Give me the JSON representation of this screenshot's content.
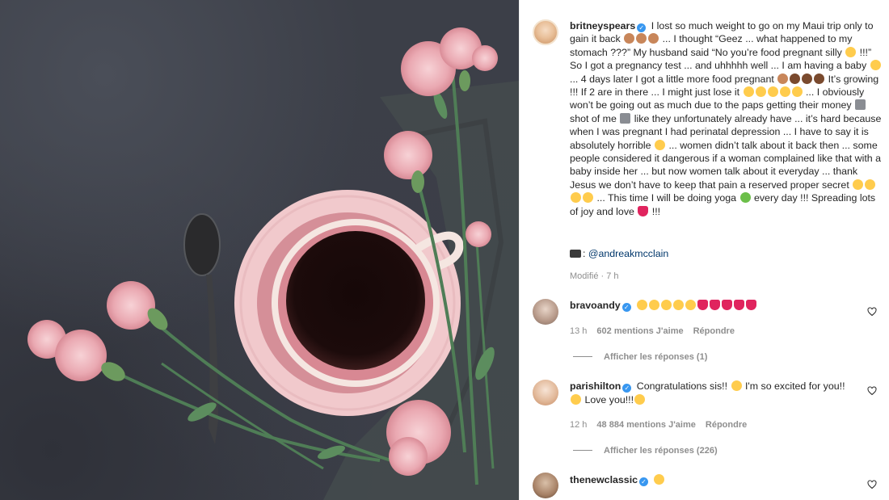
{
  "post": {
    "username": "britneyspears",
    "caption_parts": [
      " I lost so much weight to go on my Maui trip only to gain it back ",
      " ... I thought “Geez ... what happened to my stomach ???” My husband said “No you’re food pregnant silly ",
      " !!!” So I got a pregnancy test ... and uhhhhh well ... I am having a baby ",
      " ... 4 days later I got a little more food pregnant ",
      " It’s growing !!! If 2 are in there ... I might just lose it ",
      " ... I obviously won’t be going out as much due to the paps getting their money ",
      " shot of me ",
      " like they unfortunately already have ... it’s hard because when I was pregnant I had perinatal depression ... I have to say it is absolutely horrible ",
      " ... women didn’t talk about it back then ... some people considered it dangerous if a woman complained like that with a baby inside her ... but now women talk about it everyday ... thank Jesus we don’t have to keep that pain a reserved proper secret ",
      " ... This time I will be doing yoga ",
      " every day !!! Spreading lots of joy and love ",
      " !!!"
    ],
    "credit_prefix": ": ",
    "credit_handle": "@andreakmcclain",
    "modified": "Modifié · 7 h"
  },
  "comments": [
    {
      "username": "bravoandy",
      "text": "",
      "time": "13 h",
      "likes": "602 mentions J'aime",
      "reply_label": "Répondre",
      "view_replies": "Afficher les réponses (1)"
    },
    {
      "username": "parishilton",
      "text": " Congratulations sis!! ",
      "text2": " I'm so excited for you!! ",
      "text3": " Love you!!!",
      "time": "12 h",
      "likes": "48 884 mentions J'aime",
      "reply_label": "Répondre",
      "view_replies": "Afficher les réponses (226)"
    },
    {
      "username": "thenewclassic",
      "text": ""
    }
  ],
  "icons": {
    "verified": "verified-badge-icon",
    "like": "heart-outline-icon",
    "camera": "camera-icon"
  },
  "colors": {
    "link": "#00376b",
    "verified": "#3897f0",
    "muted": "#8e8e8e"
  }
}
